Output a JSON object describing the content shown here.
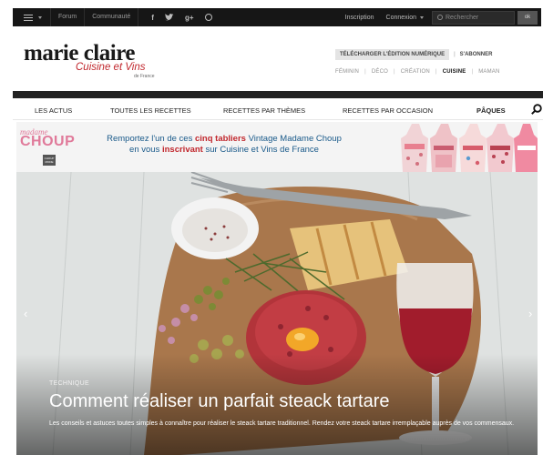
{
  "topbar": {
    "forum": "Forum",
    "communaute": "Communauté",
    "inscription": "Inscription",
    "connexion": "Connexion",
    "search_placeholder": "Rechercher",
    "search_button": "ok",
    "social": {
      "facebook": "f",
      "googleplus": "g+"
    }
  },
  "header": {
    "logo_main": "marie claire",
    "logo_sub": "Cuisine et Vins",
    "logo_small": "de France",
    "download": "TÉLÉCHARGER L'ÉDITION NUMÉRIQUE",
    "separator": "|",
    "subscribe": "S'ABONNER",
    "categories": [
      {
        "label": "FÉMININ",
        "active": false
      },
      {
        "label": "DÉCO",
        "active": false
      },
      {
        "label": "CRÉATION",
        "active": false
      },
      {
        "label": "CUISINE",
        "active": true
      },
      {
        "label": "MAMAN",
        "active": false
      }
    ]
  },
  "nav": {
    "items": [
      "LES ACTUS",
      "TOUTES LES RECETTES",
      "RECETTES PAR THÈMES",
      "RECETTES PAR OCCASION",
      "PÂQUES"
    ]
  },
  "promo": {
    "brand_line1": "madame",
    "brand_line2": "CHOUP",
    "brand_badge": "CHOUP MODE",
    "text_before": "Remportez l'un de ces ",
    "text_bold": "cinq tabliers",
    "text_after": " Vintage Madame Choup",
    "text_line2_before": "en vous ",
    "text_line2_bold": "inscrivant",
    "text_line2_after": " sur Cuisine et Vins de France"
  },
  "hero": {
    "category": "TECHNIQUE",
    "title": "Comment réaliser un parfait steack tartare",
    "description": "Les conseils et astuces toutes simples à connaître pour réaliser le steack tartare traditionnel. Rendez votre steack tartare irremplaçable auprès de vos commensaux.",
    "prev_arrow": "‹",
    "next_arrow": "›"
  },
  "colors": {
    "accent_red": "#c1272d",
    "promo_blue": "#1a5a8a",
    "topbar_bg": "#161616"
  }
}
